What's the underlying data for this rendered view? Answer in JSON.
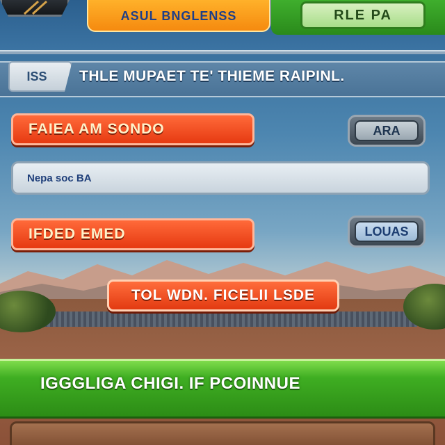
{
  "topbar": {
    "orange_button_label": "ASUL BNGLENSS",
    "green_button_label": "RLE PA"
  },
  "header": {
    "tag_label": "ISS",
    "title": "THLE MUPAET TE' THIEME RAIPINL."
  },
  "rows": [
    {
      "red_label": "FAIEA AM SONDO",
      "side_button_label": "ARA"
    },
    {
      "input_value": "Nepa soc BA"
    },
    {
      "red_label": "IFDED EMED",
      "side_button_label": "LOUAS"
    }
  ],
  "center_button_label": "TOL WDN. FICELII LSDE",
  "banner_text": "IGGGLIGA CHIGI. IF PCOINNUE",
  "colors": {
    "orange": "#f58a0f",
    "green": "#3fae22",
    "red": "#e63a12",
    "sky": "#4a7fa8"
  }
}
